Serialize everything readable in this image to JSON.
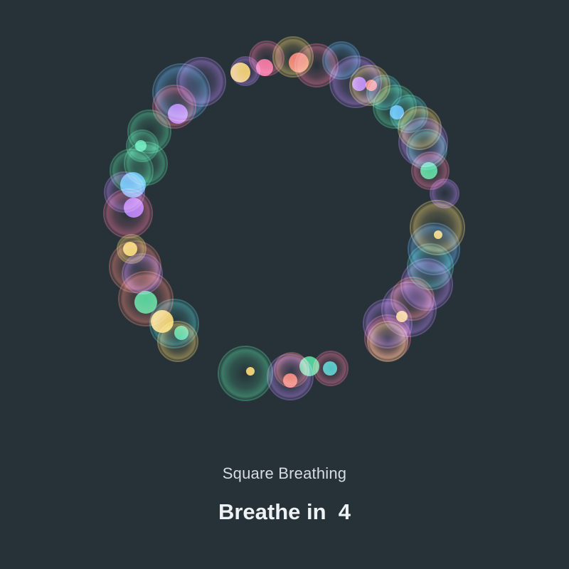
{
  "app": {
    "technique": "Square Breathing",
    "phase": "Breathe in",
    "count": "4"
  },
  "visual": {
    "background": "#263238",
    "particle_palette": [
      "#ff5a8c",
      "#b36bff",
      "#4fa8ff",
      "#3dd68c",
      "#ffd24d",
      "#ff6f5a",
      "#37c9c9"
    ]
  }
}
